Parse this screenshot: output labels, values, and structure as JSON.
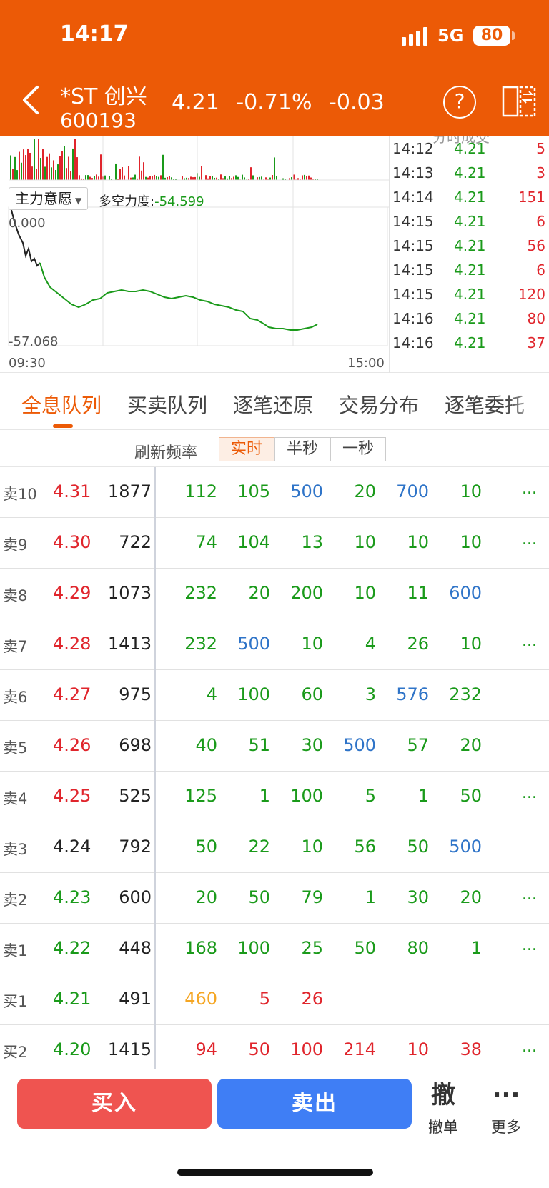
{
  "status": {
    "time": "14:17",
    "network": "5G",
    "battery": "80"
  },
  "header": {
    "name": "*ST 创兴",
    "code": "600193",
    "price": "4.21",
    "change_pct": "-0.71%",
    "change": "-0.03"
  },
  "indicator": {
    "selector_label": "主力意愿",
    "metric_label": "多空力度:",
    "metric_value": "-54.599",
    "y_top": "0.000",
    "y_bottom": "-57.068",
    "x_start": "09:30",
    "x_end": "15:00"
  },
  "ticks": {
    "header": "分时成交",
    "rows": [
      {
        "time": "14:12",
        "price": "4.21",
        "vol": "5"
      },
      {
        "time": "14:13",
        "price": "4.21",
        "vol": "3"
      },
      {
        "time": "14:14",
        "price": "4.21",
        "vol": "151"
      },
      {
        "time": "14:15",
        "price": "4.21",
        "vol": "6"
      },
      {
        "time": "14:15",
        "price": "4.21",
        "vol": "56"
      },
      {
        "time": "14:15",
        "price": "4.21",
        "vol": "6"
      },
      {
        "time": "14:15",
        "price": "4.21",
        "vol": "120"
      },
      {
        "time": "14:16",
        "price": "4.21",
        "vol": "80"
      },
      {
        "time": "14:16",
        "price": "4.21",
        "vol": "37"
      }
    ]
  },
  "tabs": [
    "全息队列",
    "买卖队列",
    "逐笔还原",
    "交易分布",
    "逐笔委托"
  ],
  "refresh": {
    "label": "刷新频率",
    "options": [
      "实时",
      "半秒",
      "一秒"
    ],
    "selected": "实时"
  },
  "queue": {
    "rows": [
      {
        "level": "卖10",
        "price": "4.31",
        "price_color": "red",
        "total": "1877",
        "orders": [
          {
            "v": "112",
            "c": "green"
          },
          {
            "v": "105",
            "c": "green"
          },
          {
            "v": "500",
            "c": "blue"
          },
          {
            "v": "20",
            "c": "green"
          },
          {
            "v": "700",
            "c": "blue"
          },
          {
            "v": "10",
            "c": "green"
          }
        ],
        "more": "..."
      },
      {
        "level": "卖9",
        "price": "4.30",
        "price_color": "red",
        "total": "722",
        "orders": [
          {
            "v": "74",
            "c": "green"
          },
          {
            "v": "104",
            "c": "green"
          },
          {
            "v": "13",
            "c": "green"
          },
          {
            "v": "10",
            "c": "green"
          },
          {
            "v": "10",
            "c": "green"
          },
          {
            "v": "10",
            "c": "green"
          }
        ],
        "more": "..."
      },
      {
        "level": "卖8",
        "price": "4.29",
        "price_color": "red",
        "total": "1073",
        "orders": [
          {
            "v": "232",
            "c": "green"
          },
          {
            "v": "20",
            "c": "green"
          },
          {
            "v": "200",
            "c": "green"
          },
          {
            "v": "10",
            "c": "green"
          },
          {
            "v": "11",
            "c": "green"
          },
          {
            "v": "600",
            "c": "blue"
          }
        ],
        "more": ""
      },
      {
        "level": "卖7",
        "price": "4.28",
        "price_color": "red",
        "total": "1413",
        "orders": [
          {
            "v": "232",
            "c": "green"
          },
          {
            "v": "500",
            "c": "blue"
          },
          {
            "v": "10",
            "c": "green"
          },
          {
            "v": "4",
            "c": "green"
          },
          {
            "v": "26",
            "c": "green"
          },
          {
            "v": "10",
            "c": "green"
          }
        ],
        "more": "..."
      },
      {
        "level": "卖6",
        "price": "4.27",
        "price_color": "red",
        "total": "975",
        "orders": [
          {
            "v": "4",
            "c": "green"
          },
          {
            "v": "100",
            "c": "green"
          },
          {
            "v": "60",
            "c": "green"
          },
          {
            "v": "3",
            "c": "green"
          },
          {
            "v": "576",
            "c": "blue"
          },
          {
            "v": "232",
            "c": "green"
          }
        ],
        "more": ""
      },
      {
        "level": "卖5",
        "price": "4.26",
        "price_color": "red",
        "total": "698",
        "orders": [
          {
            "v": "40",
            "c": "green"
          },
          {
            "v": "51",
            "c": "green"
          },
          {
            "v": "30",
            "c": "green"
          },
          {
            "v": "500",
            "c": "blue"
          },
          {
            "v": "57",
            "c": "green"
          },
          {
            "v": "20",
            "c": "green"
          }
        ],
        "more": ""
      },
      {
        "level": "卖4",
        "price": "4.25",
        "price_color": "red",
        "total": "525",
        "orders": [
          {
            "v": "125",
            "c": "green"
          },
          {
            "v": "1",
            "c": "green"
          },
          {
            "v": "100",
            "c": "green"
          },
          {
            "v": "5",
            "c": "green"
          },
          {
            "v": "1",
            "c": "green"
          },
          {
            "v": "50",
            "c": "green"
          }
        ],
        "more": "..."
      },
      {
        "level": "卖3",
        "price": "4.24",
        "price_color": "dark",
        "total": "792",
        "orders": [
          {
            "v": "50",
            "c": "green"
          },
          {
            "v": "22",
            "c": "green"
          },
          {
            "v": "10",
            "c": "green"
          },
          {
            "v": "56",
            "c": "green"
          },
          {
            "v": "50",
            "c": "green"
          },
          {
            "v": "500",
            "c": "blue"
          }
        ],
        "more": ""
      },
      {
        "level": "卖2",
        "price": "4.23",
        "price_color": "green",
        "total": "600",
        "orders": [
          {
            "v": "20",
            "c": "green"
          },
          {
            "v": "50",
            "c": "green"
          },
          {
            "v": "79",
            "c": "green"
          },
          {
            "v": "1",
            "c": "green"
          },
          {
            "v": "30",
            "c": "green"
          },
          {
            "v": "20",
            "c": "green"
          }
        ],
        "more": "..."
      },
      {
        "level": "卖1",
        "price": "4.22",
        "price_color": "green",
        "total": "448",
        "orders": [
          {
            "v": "168",
            "c": "green"
          },
          {
            "v": "100",
            "c": "green"
          },
          {
            "v": "25",
            "c": "green"
          },
          {
            "v": "50",
            "c": "green"
          },
          {
            "v": "80",
            "c": "green"
          },
          {
            "v": "1",
            "c": "green"
          }
        ],
        "more": "..."
      },
      {
        "level": "买1",
        "price": "4.21",
        "price_color": "green",
        "total": "491",
        "orders": [
          {
            "v": "460",
            "c": "orange"
          },
          {
            "v": "5",
            "c": "red"
          },
          {
            "v": "26",
            "c": "red"
          }
        ],
        "more": ""
      },
      {
        "level": "买2",
        "price": "4.20",
        "price_color": "green",
        "total": "1415",
        "orders": [
          {
            "v": "94",
            "c": "red"
          },
          {
            "v": "50",
            "c": "red"
          },
          {
            "v": "100",
            "c": "red"
          },
          {
            "v": "214",
            "c": "red"
          },
          {
            "v": "10",
            "c": "red"
          },
          {
            "v": "38",
            "c": "red"
          }
        ],
        "more": "..."
      }
    ]
  },
  "actions": {
    "buy": "买入",
    "sell": "卖出",
    "cancel_icon": "撤",
    "cancel": "撤单",
    "more_icon": "···",
    "more": "更多"
  },
  "colors": {
    "brand": "#ec5a06",
    "buy": "#ef5450",
    "sell": "#3f7ef5",
    "up": "#e0252c",
    "down": "#1a9a1a"
  }
}
